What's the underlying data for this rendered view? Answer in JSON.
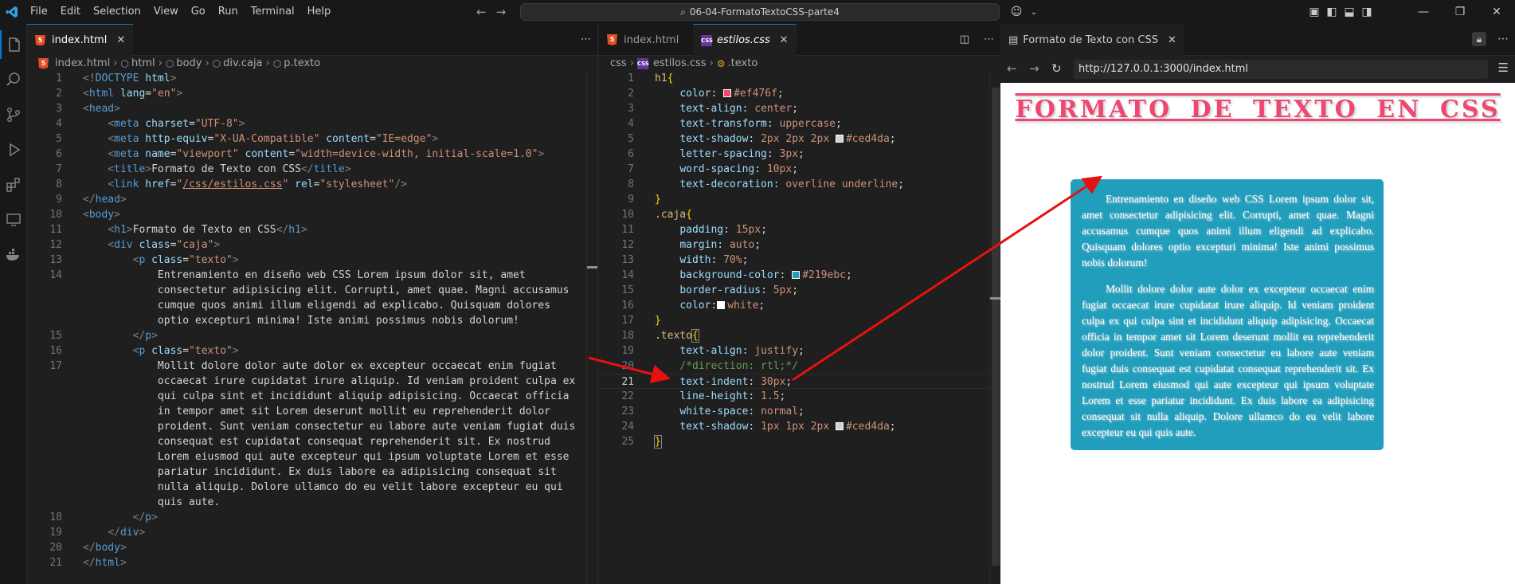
{
  "titlebar": {
    "menu": [
      "File",
      "Edit",
      "Selection",
      "View",
      "Go",
      "Run",
      "Terminal",
      "Help"
    ],
    "search": "06-04-FormatoTextoCSS-parte4"
  },
  "left_editor": {
    "tab": {
      "label": "index.html",
      "icon": "html5-icon"
    },
    "breadcrumb": [
      "index.html",
      "html",
      "body",
      "div.caja",
      "p.texto"
    ],
    "lines": [
      {
        "n": "1",
        "h": "<span class='g'>&lt;</span><span class='k'>!DOCTYPE</span> <span class='a'>html</span><span class='g'>&gt;</span>"
      },
      {
        "n": "2",
        "h": "<span class='g'>&lt;</span><span class='k'>html</span> <span class='a'>lang</span>=<span class='s'>\"en\"</span><span class='g'>&gt;</span>"
      },
      {
        "n": "3",
        "h": "<span class='g'>&lt;</span><span class='k'>head</span><span class='g'>&gt;</span>"
      },
      {
        "n": "4",
        "h": "    <span class='g'>&lt;</span><span class='k'>meta</span> <span class='a'>charset</span>=<span class='s'>\"UTF-8\"</span><span class='g'>&gt;</span>"
      },
      {
        "n": "5",
        "h": "    <span class='g'>&lt;</span><span class='k'>meta</span> <span class='a'>http-equiv</span>=<span class='s'>\"X-UA-Compatible\"</span> <span class='a'>content</span>=<span class='s'>\"IE=edge\"</span><span class='g'>&gt;</span>"
      },
      {
        "n": "6",
        "h": "    <span class='g'>&lt;</span><span class='k'>meta</span> <span class='a'>name</span>=<span class='s'>\"viewport\"</span> <span class='a'>content</span>=<span class='s'>\"width=device-width, initial-scale=1.0\"</span><span class='g'>&gt;</span>"
      },
      {
        "n": "7",
        "h": "    <span class='g'>&lt;</span><span class='k'>title</span><span class='g'>&gt;</span>Formato de Texto con CSS<span class='g'>&lt;/</span><span class='k'>title</span><span class='g'>&gt;</span>"
      },
      {
        "n": "8",
        "h": "    <span class='g'>&lt;</span><span class='k'>link</span> <span class='a'>href</span>=<span class='s'>\"<u>/css/estilos.css</u>\"</span> <span class='a'>rel</span>=<span class='s'>\"stylesheet\"</span><span class='g'>/&gt;</span>"
      },
      {
        "n": "9",
        "h": "<span class='g'>&lt;/</span><span class='k'>head</span><span class='g'>&gt;</span>"
      },
      {
        "n": "10",
        "h": "<span class='g'>&lt;</span><span class='k'>body</span><span class='g'>&gt;</span>"
      },
      {
        "n": "11",
        "h": "    <span class='g'>&lt;</span><span class='k'>h1</span><span class='g'>&gt;</span>Formato de Texto en CSS<span class='g'>&lt;/</span><span class='k'>h1</span><span class='g'>&gt;</span>"
      },
      {
        "n": "12",
        "h": "    <span class='g'>&lt;</span><span class='k'>div</span> <span class='a'>class</span>=<span class='s'>\"caja\"</span><span class='g'>&gt;</span>"
      },
      {
        "n": "13",
        "h": "        <span class='g'>&lt;</span><span class='k'>p</span> <span class='a'>class</span>=<span class='s'>\"texto\"</span><span class='g'>&gt;</span>"
      },
      {
        "n": "14",
        "h": "            Entrenamiento en diseño web CSS Lorem ipsum dolor sit, amet"
      },
      {
        "n": "",
        "h": "            consectetur adipisicing elit. Corrupti, amet quae. Magni accusamus"
      },
      {
        "n": "",
        "h": "            cumque quos animi illum eligendi ad explicabo. Quisquam dolores"
      },
      {
        "n": "",
        "h": "            optio excepturi minima! Iste animi possimus nobis dolorum!"
      },
      {
        "n": "15",
        "h": "        <span class='g'>&lt;/</span><span class='k'>p</span><span class='g'>&gt;</span>"
      },
      {
        "n": "16",
        "h": "        <span class='g'>&lt;</span><span class='k'>p</span> <span class='a'>class</span>=<span class='s'>\"texto\"</span><span class='g'>&gt;</span>"
      },
      {
        "n": "17",
        "h": "            Mollit dolore dolor aute dolor ex excepteur occaecat enim fugiat"
      },
      {
        "n": "",
        "h": "            occaecat irure cupidatat irure aliquip. Id veniam proident culpa ex"
      },
      {
        "n": "",
        "h": "            qui culpa sint et incididunt aliquip adipisicing. Occaecat officia"
      },
      {
        "n": "",
        "h": "            in tempor amet sit Lorem deserunt mollit eu reprehenderit dolor"
      },
      {
        "n": "",
        "h": "            proident. Sunt veniam consectetur eu labore aute veniam fugiat duis"
      },
      {
        "n": "",
        "h": "            consequat est cupidatat consequat reprehenderit sit. Ex nostrud"
      },
      {
        "n": "",
        "h": "            Lorem eiusmod qui aute excepteur qui ipsum voluptate Lorem et esse"
      },
      {
        "n": "",
        "h": "            pariatur incididunt. Ex duis labore ea adipisicing consequat sit"
      },
      {
        "n": "",
        "h": "            nulla aliquip. Dolore ullamco do eu velit labore excepteur eu qui"
      },
      {
        "n": "",
        "h": "            quis aute."
      },
      {
        "n": "18",
        "h": "        <span class='g'>&lt;/</span><span class='k'>p</span><span class='g'>&gt;</span>"
      },
      {
        "n": "19",
        "h": "    <span class='g'>&lt;/</span><span class='k'>div</span><span class='g'>&gt;</span>"
      },
      {
        "n": "20",
        "h": "<span class='g'>&lt;/</span><span class='k'>body</span><span class='g'>&gt;</span>"
      },
      {
        "n": "21",
        "h": "<span class='g'>&lt;/</span><span class='k'>html</span><span class='g'>&gt;</span>"
      }
    ]
  },
  "mid_editor": {
    "tabs": [
      {
        "label": "index.html",
        "icon": "html5-icon"
      },
      {
        "label": "estilos.css",
        "icon": "css-icon"
      }
    ],
    "breadcrumb": [
      "css",
      "estilos.css",
      ".texto"
    ],
    "lines": [
      {
        "n": "1",
        "h": "<span class='y'>h1</span><span class='b'>{</span>"
      },
      {
        "n": "2",
        "h": "    <span class='a'>color</span>: <span class='sw' style='background:#ef476f'></span><span class='s'>#ef476f</span>;"
      },
      {
        "n": "3",
        "h": "    <span class='a'>text-align</span>: <span class='s'>center</span>;"
      },
      {
        "n": "4",
        "h": "    <span class='a'>text-transform</span>: <span class='s'>uppercase</span>;"
      },
      {
        "n": "5",
        "h": "    <span class='a'>text-shadow</span>: <span class='s'>2px 2px 2px</span> <span class='sw' style='background:#ced4da'></span><span class='s'>#ced4da</span>;"
      },
      {
        "n": "6",
        "h": "    <span class='a'>letter-spacing</span>: <span class='s'>3px</span>;"
      },
      {
        "n": "7",
        "h": "    <span class='a'>word-spacing</span>: <span class='s'>10px</span>;"
      },
      {
        "n": "8",
        "h": "    <span class='a'>text-decoration</span>: <span class='s'>overline underline</span>;"
      },
      {
        "n": "9",
        "h": "<span class='b'>}</span>"
      },
      {
        "n": "10",
        "h": "<span class='y'>.caja</span><span class='b'>{</span>"
      },
      {
        "n": "11",
        "h": "    <span class='a'>padding</span>: <span class='s'>15px</span>;"
      },
      {
        "n": "12",
        "h": "    <span class='a'>margin</span>: <span class='s'>auto</span>;"
      },
      {
        "n": "13",
        "h": "    <span class='a'>width</span>: <span class='s'>70%</span>;"
      },
      {
        "n": "14",
        "h": "    <span class='a'>background-color</span>: <span class='sw' style='background:#219ebc'></span><span class='s'>#219ebc</span>;"
      },
      {
        "n": "15",
        "h": "    <span class='a'>border-radius</span>: <span class='s'>5px</span>;"
      },
      {
        "n": "16",
        "h": "    <span class='a'>color</span>:<span class='sw' style='background:#ffffff'></span><span class='s'>white</span>;"
      },
      {
        "n": "17",
        "h": "<span class='b'>}</span>"
      },
      {
        "n": "18",
        "h": "<span class='y'>.texto</span><span class='b' style='outline:1px solid #888'>{</span>"
      },
      {
        "n": "19",
        "h": "    <span class='a'>text-align</span>: <span class='s'>justify</span>;"
      },
      {
        "n": "20",
        "h": "    <span class='cm'>/*direction: rtl;*/</span>"
      },
      {
        "n": "21",
        "h": "    <span class='a'>text-indent</span>: <span class='s'>30px</span>;"
      },
      {
        "n": "22",
        "h": "    <span class='a'>line-height</span>: <span class='s'>1.5</span>;"
      },
      {
        "n": "23",
        "h": "    <span class='a'>white-space</span>: <span class='s'>normal</span>;"
      },
      {
        "n": "24",
        "h": "    <span class='a'>text-shadow</span>: <span class='s'>1px 1px 2px</span> <span class='sw' style='background:#ced4da'></span><span class='s'>#ced4da</span>;"
      },
      {
        "n": "25",
        "h": "<span class='b' style='outline:1px solid #888'>}</span>"
      }
    ]
  },
  "browser": {
    "tab": "Formato de Texto con CSS",
    "url": "http://127.0.0.1:3000/index.html",
    "heading": "Formato de Texto en CSS",
    "paragraphs": [
      "Entrenamiento en diseño web CSS Lorem ipsum dolor sit, amet consectetur adipisicing elit. Corrupti, amet quae. Magni accusamus cumque quos animi illum eligendi ad explicabo. Quisquam dolores optio excepturi minima! Iste animi possimus nobis dolorum!",
      "Mollit dolore dolor aute dolor ex excepteur occaecat enim fugiat occaecat irure cupidatat irure aliquip. Id veniam proident culpa ex qui culpa sint et incididunt aliquip adipisicing. Occaecat officia in tempor amet sit Lorem deserunt mollit eu reprehenderit dolor proident. Sunt veniam consectetur eu labore aute veniam fugiat duis consequat est cupidatat consequat reprehenderit sit. Ex nostrud Lorem eiusmod qui aute excepteur qui ipsum voluptate Lorem et esse pariatur incididunt. Ex duis labore ea adipisicing consequat sit nulla aliquip. Dolore ullamco do eu velit labore excepteur eu qui quis aute."
    ]
  },
  "colors": {
    "accent": "#0078d4",
    "heading": "#ef476f",
    "box": "#219ebc",
    "shadow": "#ced4da",
    "annotation": "#e81010"
  }
}
